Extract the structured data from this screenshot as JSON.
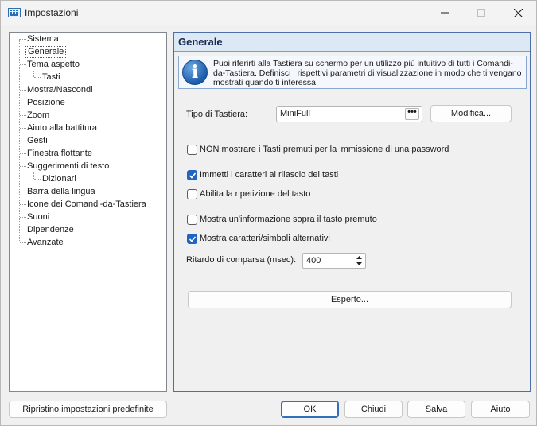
{
  "window": {
    "title": "Impostazioni",
    "accent_color": "#2f6fbd"
  },
  "tree": {
    "items": [
      {
        "label": "Sistema",
        "level": 0
      },
      {
        "label": "Generale",
        "level": 0,
        "selected": true
      },
      {
        "label": "Tema aspetto",
        "level": 0
      },
      {
        "label": "Tasti",
        "level": 1
      },
      {
        "label": "Mostra/Nascondi",
        "level": 0
      },
      {
        "label": "Posizione",
        "level": 0
      },
      {
        "label": "Zoom",
        "level": 0
      },
      {
        "label": "Aiuto alla battitura",
        "level": 0
      },
      {
        "label": "Gesti",
        "level": 0
      },
      {
        "label": "Finestra flottante",
        "level": 0
      },
      {
        "label": "Suggerimenti di testo",
        "level": 0
      },
      {
        "label": "Dizionari",
        "level": 1
      },
      {
        "label": "Barra della lingua",
        "level": 0
      },
      {
        "label": "Icone dei Comandi-da-Tastiera",
        "level": 0
      },
      {
        "label": "Suoni",
        "level": 0
      },
      {
        "label": "Dipendenze",
        "level": 0
      },
      {
        "label": "Avanzate",
        "level": 0
      }
    ]
  },
  "panel": {
    "title": "Generale",
    "info_text": "Puoi riferirti alla Tastiera su schermo per un utilizzo più intuitivo di tutti i Comandi-da-Tastiera. Definisci i rispettivi parametri di visualizzazione in modo che ti vengano mostrati quando ti interessa.",
    "keyboard_type_label": "Tipo di Tastiera:",
    "keyboard_type_value": "MiniFull",
    "browse_label": "•••",
    "modify_button": "Modifica...",
    "options": [
      {
        "label": "NON mostrare i Tasti premuti per la immissione di una password",
        "checked": false
      },
      {
        "label": "Immetti i caratteri al rilascio dei tasti",
        "checked": true
      },
      {
        "label": "Abilita la ripetizione del tasto",
        "checked": false
      },
      {
        "label": "Mostra un'informazione sopra il tasto premuto",
        "checked": false
      },
      {
        "label": "Mostra caratteri/simboli alternativi",
        "checked": true
      }
    ],
    "delay_label": "Ritardo di comparsa (msec):",
    "delay_value": "400",
    "expert_button": "Esperto..."
  },
  "footer": {
    "reset_button": "Ripristino impostazioni predefinite",
    "ok_button": "OK",
    "cancel_button": "Chiudi",
    "save_button": "Salva",
    "help_button": "Aiuto"
  }
}
